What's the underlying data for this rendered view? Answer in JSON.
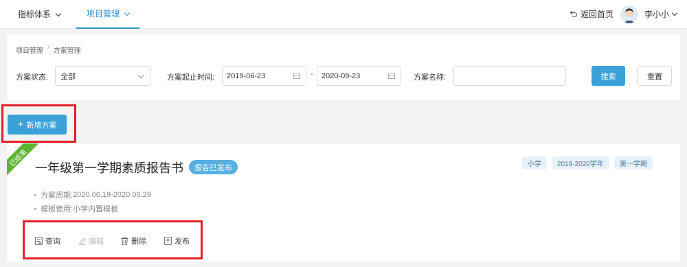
{
  "nav": {
    "items": [
      {
        "label": "指标体系"
      },
      {
        "label": "项目管理"
      }
    ],
    "home_label": "返回首页",
    "user_name": "李小小"
  },
  "breadcrumb": [
    "项目管理",
    "方案管理"
  ],
  "filters": {
    "status_label": "方案状态:",
    "status_value": "全部",
    "date_label": "方案起止时间:",
    "start_date": "2019-06-23",
    "end_date": "2020-09-23",
    "range_separator": "-",
    "name_label": "方案名称:",
    "name_value": "",
    "search_button": "搜索",
    "reset_button": "重置"
  },
  "add_button": "新增方案",
  "plan": {
    "ribbon": "已结束",
    "title": "一年级第一学期素质报告书",
    "status": "报告已发布",
    "tags": [
      "小学",
      "2019-2020学年",
      "第一学期"
    ],
    "period_label": "方案周期:",
    "period_value": "2020.06.19-2020.06.29",
    "template_label": "模板使用:",
    "template_value": "小学内置模板",
    "actions": [
      {
        "label": "查询",
        "icon": "view-icon",
        "enabled": true
      },
      {
        "label": "编辑",
        "icon": "edit-icon",
        "enabled": false
      },
      {
        "label": "删除",
        "icon": "trash-icon",
        "enabled": true
      },
      {
        "label": "发布",
        "icon": "publish-icon",
        "enabled": true
      }
    ]
  },
  "colors": {
    "accent": "#3aa0d8",
    "ribbon": "#5cb531",
    "highlight": "#e41e26"
  }
}
